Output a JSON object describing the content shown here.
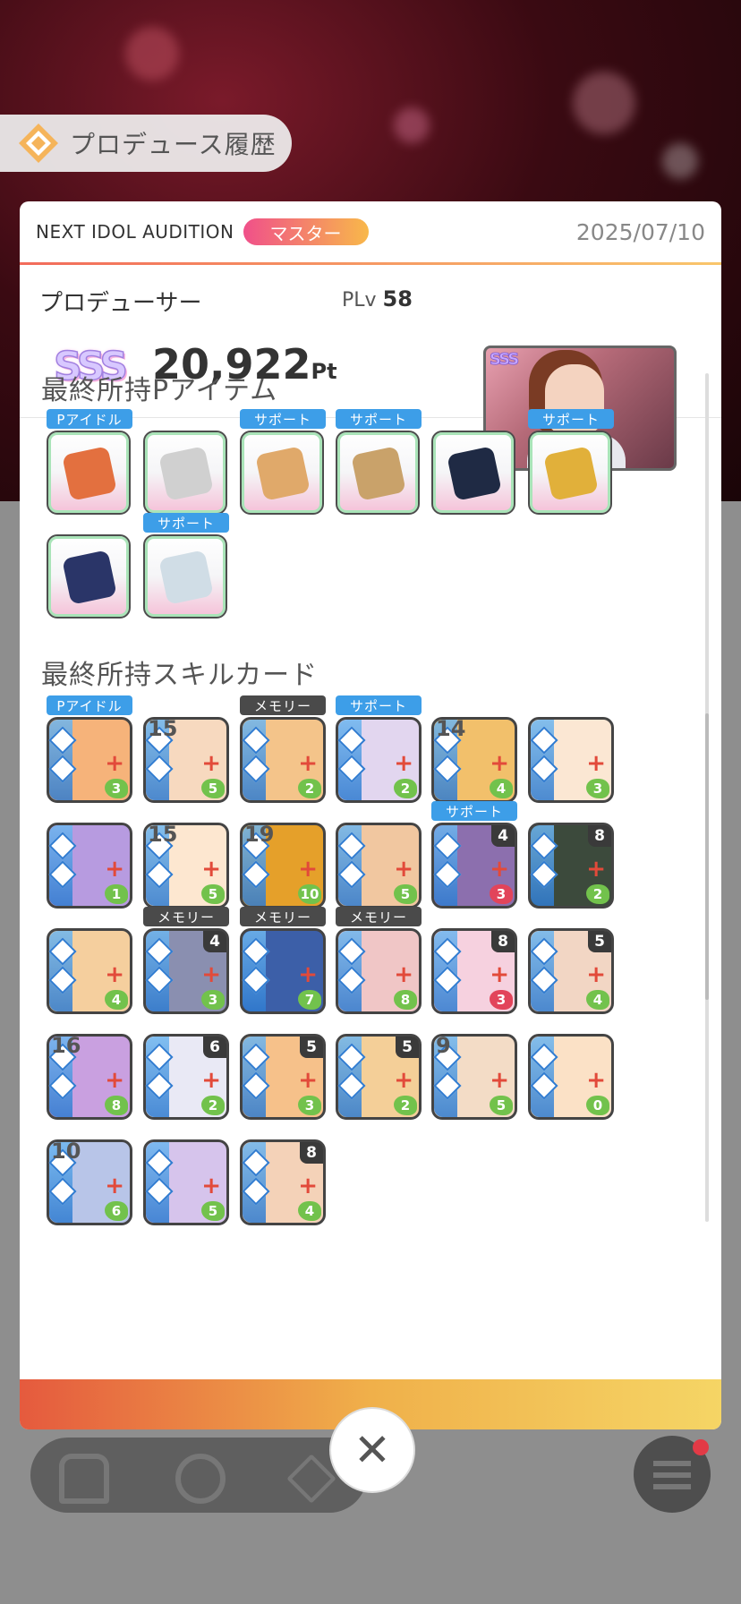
{
  "header": {
    "title": "プロデュース履歴"
  },
  "modal": {
    "audition": "NEXT IDOL AUDITION",
    "rank": "マスター",
    "date": "2025/07/10",
    "producer_label": "プロデューサー",
    "plv_label": "PLv",
    "plv_value": "58",
    "grade": "SSS",
    "points_value": "20,922",
    "points_unit": "Pt",
    "thumb_grade": "SSS"
  },
  "items_section": {
    "title": "最終所持Pアイテム",
    "items": [
      {
        "label": "Pアイドル",
        "icon": "orange-scarf-icon"
      },
      {
        "label": "",
        "icon": "snack-bag-icon"
      },
      {
        "label": "サポート",
        "icon": "meal-bowls-icon"
      },
      {
        "label": "サポート",
        "icon": "cardboard-box-icon"
      },
      {
        "label": "",
        "icon": "tote-bag-icon"
      },
      {
        "label": "サポート",
        "icon": "wood-sticks-icon"
      },
      {
        "label": "",
        "icon": "wristband-icon"
      },
      {
        "label": "サポート",
        "icon": "bento-box-icon"
      }
    ]
  },
  "cards_section": {
    "title": "最終所持スキルカード",
    "cards": [
      {
        "label": "Pアイドル",
        "num": "",
        "corner": "",
        "drop": "3",
        "drop_color": "green",
        "bg": "#f6b37a"
      },
      {
        "label": "",
        "num": "15",
        "corner": "",
        "drop": "5",
        "drop_color": "green",
        "bg": "#f7d9bf"
      },
      {
        "label": "メモリー",
        "num": "",
        "corner": "",
        "drop": "2",
        "drop_color": "green",
        "bg": "#f4c48a"
      },
      {
        "label": "サポート",
        "num": "",
        "corner": "",
        "drop": "2",
        "drop_color": "green",
        "bg": "#e2d6ef"
      },
      {
        "label": "",
        "num": "14",
        "corner": "",
        "drop": "4",
        "drop_color": "green",
        "bg": "#f2c06b"
      },
      {
        "label": "",
        "num": "",
        "corner": "",
        "drop": "3",
        "drop_color": "green",
        "bg": "#fbe7d3"
      },
      {
        "label": "",
        "num": "",
        "corner": "",
        "drop": "1",
        "drop_color": "green",
        "bg": "#b79be0"
      },
      {
        "label": "",
        "num": "15",
        "corner": "",
        "drop": "5",
        "drop_color": "green",
        "bg": "#fde7d0"
      },
      {
        "label": "",
        "num": "19",
        "corner": "",
        "drop": "10",
        "drop_color": "green",
        "bg": "#e5a02a"
      },
      {
        "label": "",
        "num": "",
        "corner": "",
        "drop": "5",
        "drop_color": "green",
        "bg": "#f1c7a0"
      },
      {
        "label": "サポート",
        "num": "",
        "corner": "4",
        "drop": "3",
        "drop_color": "red",
        "bg": "#8c6fae"
      },
      {
        "label": "",
        "num": "",
        "corner": "8",
        "drop": "2",
        "drop_color": "green",
        "bg": "#3c4a3c"
      },
      {
        "label": "",
        "num": "",
        "corner": "",
        "drop": "4",
        "drop_color": "green",
        "bg": "#f5cf9e"
      },
      {
        "label": "メモリー",
        "num": "",
        "corner": "4",
        "drop": "3",
        "drop_color": "green",
        "bg": "#8a8fb0"
      },
      {
        "label": "メモリー",
        "num": "",
        "corner": "",
        "drop": "7",
        "drop_color": "green",
        "bg": "#3c5fa8"
      },
      {
        "label": "メモリー",
        "num": "",
        "corner": "",
        "drop": "8",
        "drop_color": "green",
        "bg": "#f0c6c6"
      },
      {
        "label": "",
        "num": "",
        "corner": "8",
        "drop": "3",
        "drop_color": "red",
        "bg": "#f6d1df"
      },
      {
        "label": "",
        "num": "",
        "corner": "5",
        "drop": "4",
        "drop_color": "green",
        "bg": "#f2d6c4"
      },
      {
        "label": "",
        "num": "16",
        "corner": "",
        "drop": "8",
        "drop_color": "green",
        "bg": "#c9a0e0"
      },
      {
        "label": "",
        "num": "",
        "corner": "6",
        "drop": "2",
        "drop_color": "green",
        "bg": "#e9e9f5"
      },
      {
        "label": "",
        "num": "",
        "corner": "5",
        "drop": "3",
        "drop_color": "green",
        "bg": "#f6c18a"
      },
      {
        "label": "",
        "num": "",
        "corner": "5",
        "drop": "2",
        "drop_color": "green",
        "bg": "#f4cf98"
      },
      {
        "label": "",
        "num": "9",
        "corner": "",
        "drop": "5",
        "drop_color": "green",
        "bg": "#f3dcc6"
      },
      {
        "label": "",
        "num": "",
        "corner": "",
        "drop": "0",
        "drop_color": "green",
        "bg": "#fbe1c6"
      },
      {
        "label": "",
        "num": "10",
        "corner": "",
        "drop": "6",
        "drop_color": "green",
        "bg": "#b8c5e8"
      },
      {
        "label": "",
        "num": "",
        "corner": "",
        "drop": "5",
        "drop_color": "green",
        "bg": "#d6c4ec"
      },
      {
        "label": "",
        "num": "",
        "corner": "8",
        "drop": "4",
        "drop_color": "green",
        "bg": "#f4d2b8"
      }
    ]
  },
  "controls": {
    "close": "✕"
  }
}
